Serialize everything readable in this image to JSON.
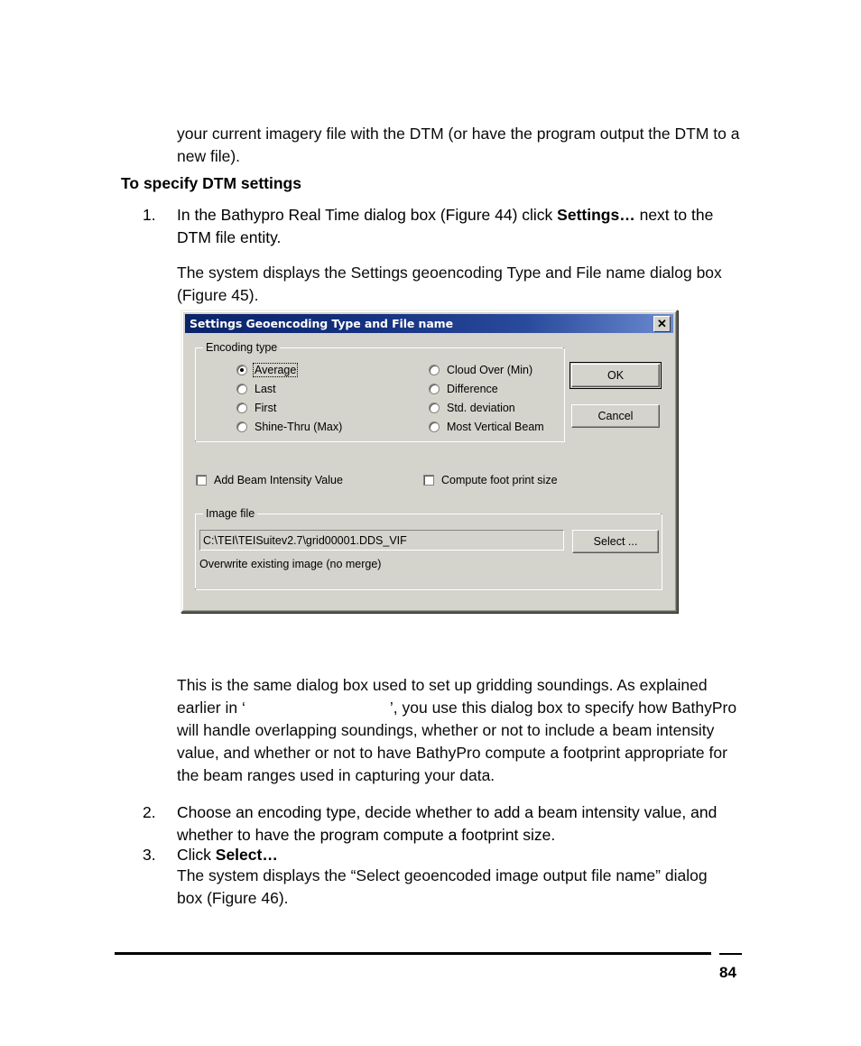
{
  "document": {
    "top_paragraph": "your current imagery file with the DTM (or have the program output the DTM to a new file).",
    "heading": "To specify DTM settings",
    "steps": [
      {
        "number": "1.",
        "text_before_bold": "In the Bathypro Real Time dialog box (Figure 44) click ",
        "bold": "Settings…",
        "text_after_bold": " next to the DTM file entity."
      },
      {
        "number": "2.",
        "text_before_bold": "Choose an encoding type, decide whether to add a beam intensity value, and whether to have the program compute a footprint size.",
        "bold": "",
        "text_after_bold": ""
      },
      {
        "number": "3.",
        "text_before_bold": "Click ",
        "bold": "Select…",
        "text_after_bold": ""
      }
    ],
    "step1_result": "The system displays the Settings geoencoding Type and File name dialog box (Figure 45).",
    "figure_caption_paragraph_part1": "This is the same dialog box used to set up gridding soundings. As explained earlier in ‘",
    "figure_caption_paragraph_part2": "’, you use this dialog box to specify how BathyPro will handle overlapping soundings, whether or not to include a beam intensity value, and whether or not to have BathyPro compute a footprint appropriate for the beam ranges used in capturing your data.",
    "step3_result": "The system displays the “Select geoencoded image output file name” dialog box (Figure 46).",
    "page_number": "84"
  },
  "dialog": {
    "title": "Settings Geoencoding Type and File name",
    "close_icon_glyph": "✕",
    "encoding_group": {
      "legend": "Encoding type",
      "left_options": [
        {
          "label": "Average",
          "selected": true,
          "focused": true
        },
        {
          "label": "Last",
          "selected": false,
          "focused": false
        },
        {
          "label": "First",
          "selected": false,
          "focused": false
        },
        {
          "label": "Shine-Thru (Max)",
          "selected": false,
          "focused": false
        }
      ],
      "right_options": [
        {
          "label": "Cloud Over (Min)",
          "selected": false,
          "focused": false
        },
        {
          "label": "Difference",
          "selected": false,
          "focused": false
        },
        {
          "label": "Std. deviation",
          "selected": false,
          "focused": false
        },
        {
          "label": "Most Vertical Beam",
          "selected": false,
          "focused": false
        }
      ]
    },
    "checkboxes": [
      {
        "label": "Add Beam Intensity Value",
        "checked": false
      },
      {
        "label": "Compute foot print size",
        "checked": false
      }
    ],
    "image_file_group": {
      "legend": "Image file",
      "path_value": "C:\\TEI\\TEISuitev2.7\\grid00001.DDS_VIF",
      "select_button": "Select ...",
      "status_text": "Overwrite existing image (no merge)"
    },
    "buttons": {
      "ok": "OK",
      "cancel": "Cancel"
    },
    "colors": {
      "face": "#d4d4cc",
      "titlebar_left": "#0a246a",
      "titlebar_right": "#6a8ad0",
      "title_text": "#ffffff"
    }
  }
}
